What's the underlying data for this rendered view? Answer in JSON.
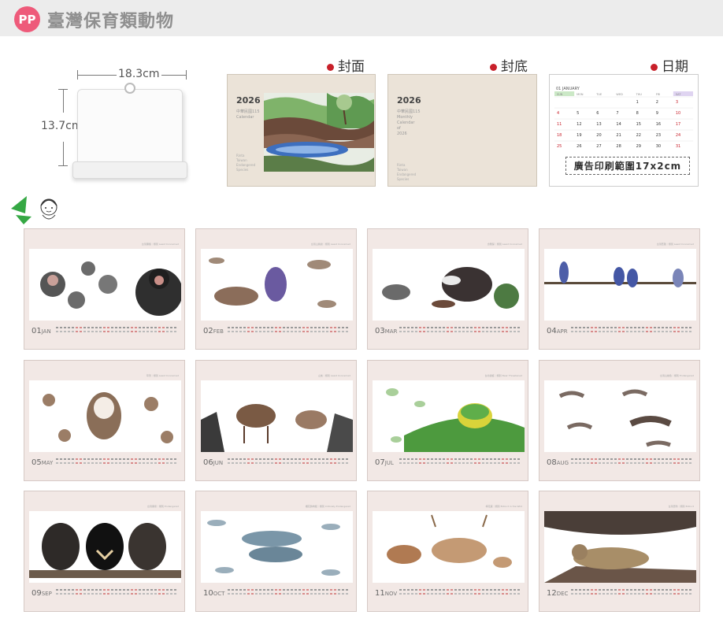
{
  "header": {
    "badge": "PP",
    "title": "臺灣保育類動物"
  },
  "dimensions": {
    "width": "18.3cm",
    "height": "13.7cm"
  },
  "labels": {
    "front": "封面",
    "back": "封底",
    "date": "日期"
  },
  "front_cover": {
    "year": "2026",
    "subtitle_lines": [
      "中華民國115",
      "Calendar"
    ],
    "footer_lines": [
      "Rinta",
      "Taiwan",
      "Endangered",
      "Species"
    ]
  },
  "back_cover": {
    "year": "2026",
    "subtitle_lines": [
      "中華民國115",
      "Monthly",
      "Calendar",
      "of",
      "2026"
    ],
    "footer_lines": [
      "Rinta",
      "Taiwan",
      "Endangered",
      "Species"
    ]
  },
  "date_card": {
    "month_header": "01 JANUARY",
    "weekdays": [
      "SUN",
      "MON",
      "TUE",
      "WED",
      "THU",
      "FRI",
      "SAT"
    ],
    "weeks": [
      [
        "",
        "",
        "",
        "",
        "1",
        "2",
        "3"
      ],
      [
        "4",
        "5",
        "6",
        "7",
        "8",
        "9",
        "10"
      ],
      [
        "11",
        "12",
        "13",
        "14",
        "15",
        "16",
        "17"
      ],
      [
        "18",
        "19",
        "20",
        "21",
        "22",
        "23",
        "24"
      ],
      [
        "25",
        "26",
        "27",
        "28",
        "29",
        "30",
        "31"
      ]
    ],
    "note": "廣告印刷範圍17x2cm"
  },
  "colors": {
    "accent": "#c8202a",
    "card_bg": "#f2e8e5",
    "header_gray": "#8f8f8f",
    "badge": "#ee5a7a"
  },
  "months": [
    {
      "num": "01",
      "abbr": "JAN",
      "title": "台灣獼猴｜類別 Least Concerned",
      "animal": "monkey"
    },
    {
      "num": "02",
      "abbr": "FEB",
      "title": "台灣山鷓鴣｜類別 Least Concerned",
      "animal": "pheasant"
    },
    {
      "num": "03",
      "abbr": "MAR",
      "title": "食蟹獴｜類別 Least Concerned",
      "animal": "badger"
    },
    {
      "num": "04",
      "abbr": "APR",
      "title": "台灣藍鵲｜類別 Least Concerned",
      "animal": "magpie"
    },
    {
      "num": "05",
      "abbr": "MAY",
      "title": "草鴞｜類別 Least Concerned",
      "animal": "owl"
    },
    {
      "num": "06",
      "abbr": "JUN",
      "title": "山羌｜類別 Least Concerned",
      "animal": "muntjac"
    },
    {
      "num": "07",
      "abbr": "JUL",
      "title": "台北樹蛙｜類別 Near Threatened",
      "animal": "frog"
    },
    {
      "num": "08",
      "abbr": "AUG",
      "title": "台灣山椒魚｜類別 Endangered",
      "animal": "salamander"
    },
    {
      "num": "09",
      "abbr": "SEP",
      "title": "台灣黑熊｜類別 Endangered",
      "animal": "bear"
    },
    {
      "num": "10",
      "abbr": "OCT",
      "title": "櫻花鉤吻鮭｜類別 Critically Endangered",
      "animal": "salmon"
    },
    {
      "num": "11",
      "abbr": "NOV",
      "title": "梅花鹿｜類別 Extinct in the Wild",
      "animal": "deer"
    },
    {
      "num": "12",
      "abbr": "DEC",
      "title": "台灣雲豹｜類別 Extinct",
      "animal": "leopard"
    }
  ]
}
